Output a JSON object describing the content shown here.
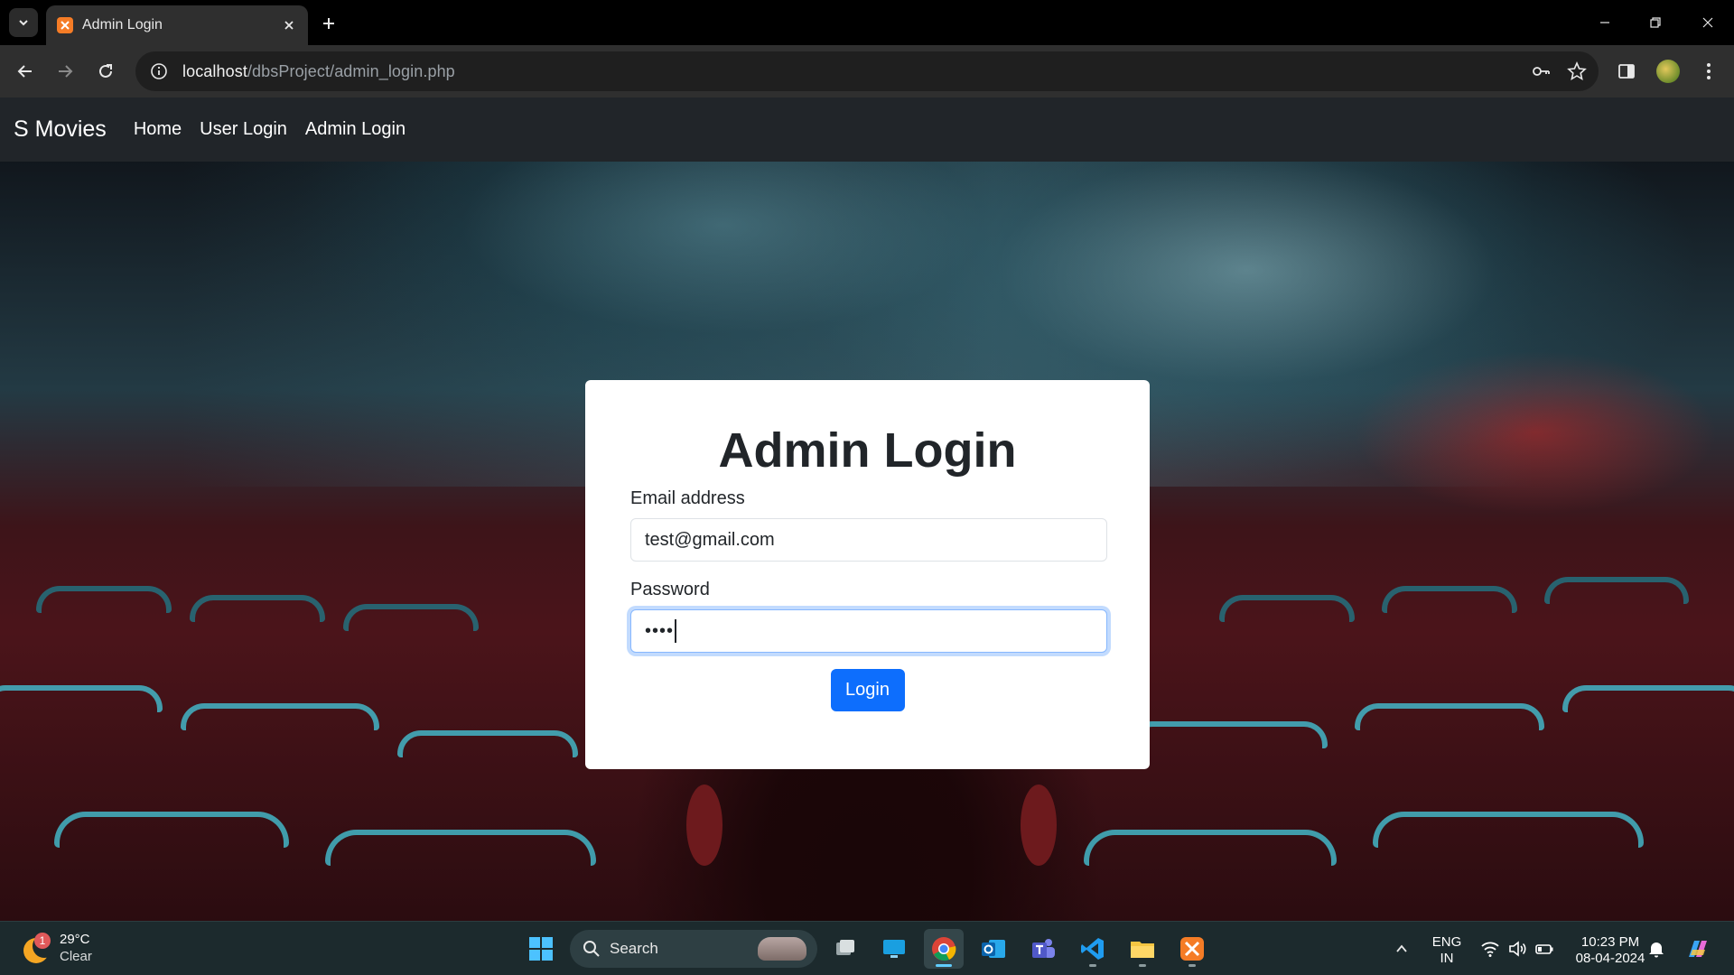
{
  "browser": {
    "tab_title": "Admin Login",
    "url_host": "localhost",
    "url_path": "/dbsProject/admin_login.php"
  },
  "navbar": {
    "brand": "S Movies",
    "links": [
      "Home",
      "User Login",
      "Admin Login"
    ]
  },
  "login": {
    "heading": "Admin Login",
    "email_label": "Email address",
    "email_value": "test@gmail.com",
    "password_label": "Password",
    "password_mask": "••••",
    "button_label": "Login"
  },
  "taskbar": {
    "weather_badge": "1",
    "temperature": "29°C",
    "condition": "Clear",
    "search_label": "Search",
    "lang_primary": "ENG",
    "lang_secondary": "IN",
    "time": "10:23 PM",
    "date": "08-04-2024"
  },
  "colors": {
    "primary": "#0d6efd",
    "navbar_bg": "#212529",
    "favicon": "#f57c26"
  }
}
